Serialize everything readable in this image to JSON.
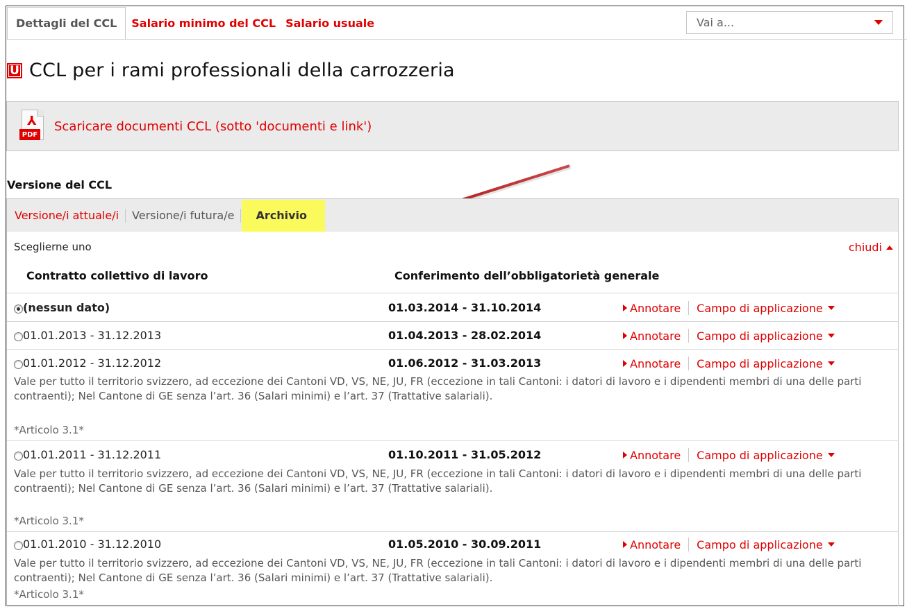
{
  "top_tabs": {
    "details": "Dettagli del CCL",
    "minimum_wage": "Salario minimo del CCL",
    "usual_wage": "Salario usuale"
  },
  "goto_select": {
    "value": "Vai a..."
  },
  "badge": "U",
  "page_title": "CCL per i rami professionali della carrozzeria",
  "download": {
    "icon_label": "PDF",
    "link": "Scaricare documenti CCL (sotto 'documenti e link')"
  },
  "version_section": {
    "title": "Versione del CCL",
    "tabs": {
      "current": "Versione/i attuale/i",
      "future": "Versione/i futura/e",
      "archive": "Archivio"
    },
    "choose": "Sceglierne uno",
    "close": "chiudi",
    "columns": {
      "ccl": "Contratto collettivo di lavoro",
      "declaration": "Conferimento dell’obbligatorietà generale"
    },
    "annotate_label": "Annotare",
    "scope_label": "Campo di applicazione",
    "rows": [
      {
        "ccl": "(nessun dato)",
        "date": "01.03.2014 - 31.10.2014",
        "selected": true
      },
      {
        "ccl": "01.01.2013 - 31.12.2013",
        "date": "01.04.2013 - 28.02.2014",
        "selected": false
      },
      {
        "ccl": "01.01.2012 - 31.12.2012",
        "date": "01.06.2012 - 31.03.2013",
        "selected": false,
        "description": "Vale per tutto il territorio svizzero, ad eccezione dei Cantoni VD, VS, NE, JU, FR (eccezione in tali Cantoni: i datori di lavoro e i dipendenti membri di una delle parti contraenti); Nel Cantone di GE senza l’art. 36 (Salari minimi) e l’art. 37 (Trattative salariali).",
        "article": "*Articolo 3.1*"
      },
      {
        "ccl": "01.01.2011 - 31.12.2011",
        "date": "01.10.2011 - 31.05.2012",
        "selected": false,
        "description": "Vale per tutto il territorio svizzero, ad eccezione dei Cantoni VD, VS, NE, JU, FR (eccezione in tali Cantoni: i datori di lavoro e i dipendenti membri di una delle parti contraenti); Nel Cantone di GE senza l’art. 36 (Salari minimi) e l’art. 37 (Trattative salariali).",
        "article": "*Articolo 3.1*"
      },
      {
        "ccl": "01.01.2010 - 31.12.2010",
        "date": "01.05.2010 - 30.09.2011",
        "selected": false,
        "description": "Vale per tutto il territorio svizzero, ad eccezione dei Cantoni VD, VS, NE, JU, FR (eccezione in tali Cantoni: i datori di lavoro e i dipendenti membri di una delle parti contraenti); Nel Cantone di GE senza l’art. 36 (Salari minimi) e l’art. 37 (Trattative salariali).",
        "article": "*Articolo 3.1*"
      }
    ]
  },
  "colors": {
    "accent": "#e00000",
    "highlight": "#fafa5c",
    "arrow": "#c41e1e"
  }
}
